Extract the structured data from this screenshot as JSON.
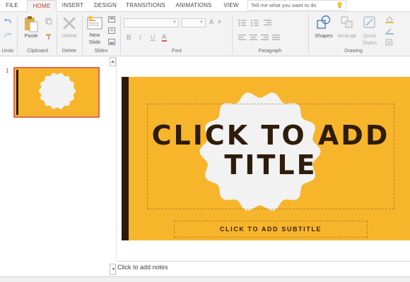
{
  "tabs": [
    "FILE",
    "HOME",
    "INSERT",
    "DESIGN",
    "TRANSITIONS",
    "ANIMATIONS",
    "VIEW"
  ],
  "active_tab": "HOME",
  "tell_me": {
    "placeholder": "Tell me what you want to do"
  },
  "ribbon": {
    "undo": {
      "group": "Undo"
    },
    "clipboard": {
      "paste": "Paste",
      "group": "Clipboard"
    },
    "delete": {
      "delete": "Delete",
      "group": "Delete"
    },
    "slides": {
      "new_slide_1": "New",
      "new_slide_2": "Slide",
      "group": "Slides"
    },
    "font": {
      "bold": "B",
      "italic": "I",
      "underline": "U",
      "font_color": "A",
      "grow": "A",
      "shrink": "A",
      "group": "Font"
    },
    "paragraph": {
      "group": "Paragraph"
    },
    "drawing": {
      "shapes": "Shapes",
      "arrange": "Arrange",
      "quick_styles_1": "Quick",
      "quick_styles_2": "Styles",
      "group": "Drawing"
    }
  },
  "thumbnails": {
    "slide_number": "1"
  },
  "slide": {
    "title": "CLICK TO ADD TITLE",
    "subtitle": "CLICK TO ADD SUBTITLE"
  },
  "notes": {
    "placeholder": "Click to add notes"
  },
  "colors": {
    "accent": "#c43e1c",
    "slide_background": "#f7b52c",
    "slide_bar": "#2b1a0c",
    "badge": "#f2f2f2",
    "title_text": "#2e1c0c"
  },
  "icons": [
    "undo-icon",
    "redo-icon",
    "paste-icon",
    "copy-icon",
    "format-painter-icon",
    "delete-icon",
    "new-slide-icon",
    "layout-icon",
    "reset-icon",
    "section-icon",
    "bullets-icon",
    "numbering-icon",
    "indent-icon",
    "align-left-icon",
    "align-center-icon",
    "align-right-icon",
    "justify-icon",
    "shapes-icon",
    "arrange-icon",
    "quick-styles-icon",
    "shape-fill-icon",
    "shape-outline-icon",
    "shape-effects-icon",
    "lightbulb-icon",
    "scroll-up-icon",
    "scroll-down-icon",
    "badge-icon"
  ]
}
